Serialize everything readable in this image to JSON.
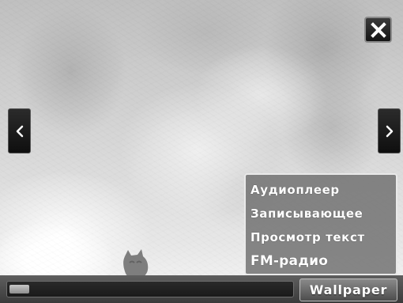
{
  "viewer": {
    "image_description_icon": "photo-background"
  },
  "controls": {
    "close_icon": "close-icon",
    "prev_icon": "chevron-left-icon",
    "next_icon": "chevron-right-icon"
  },
  "menu": {
    "items": [
      {
        "label": "Аудиоплеер"
      },
      {
        "label": "Записывающее"
      },
      {
        "label": "Просмотр текст"
      },
      {
        "label": "FM-радио"
      }
    ]
  },
  "bottom_bar": {
    "progress": 0.07,
    "wallpaper_label": "Wallpaper"
  },
  "colors": {
    "menu_background": "#6e6e6e",
    "menu_border": "#e9e9e9",
    "bar_background": "#4a4a4a",
    "progress_fill": "#b0b0b0"
  }
}
